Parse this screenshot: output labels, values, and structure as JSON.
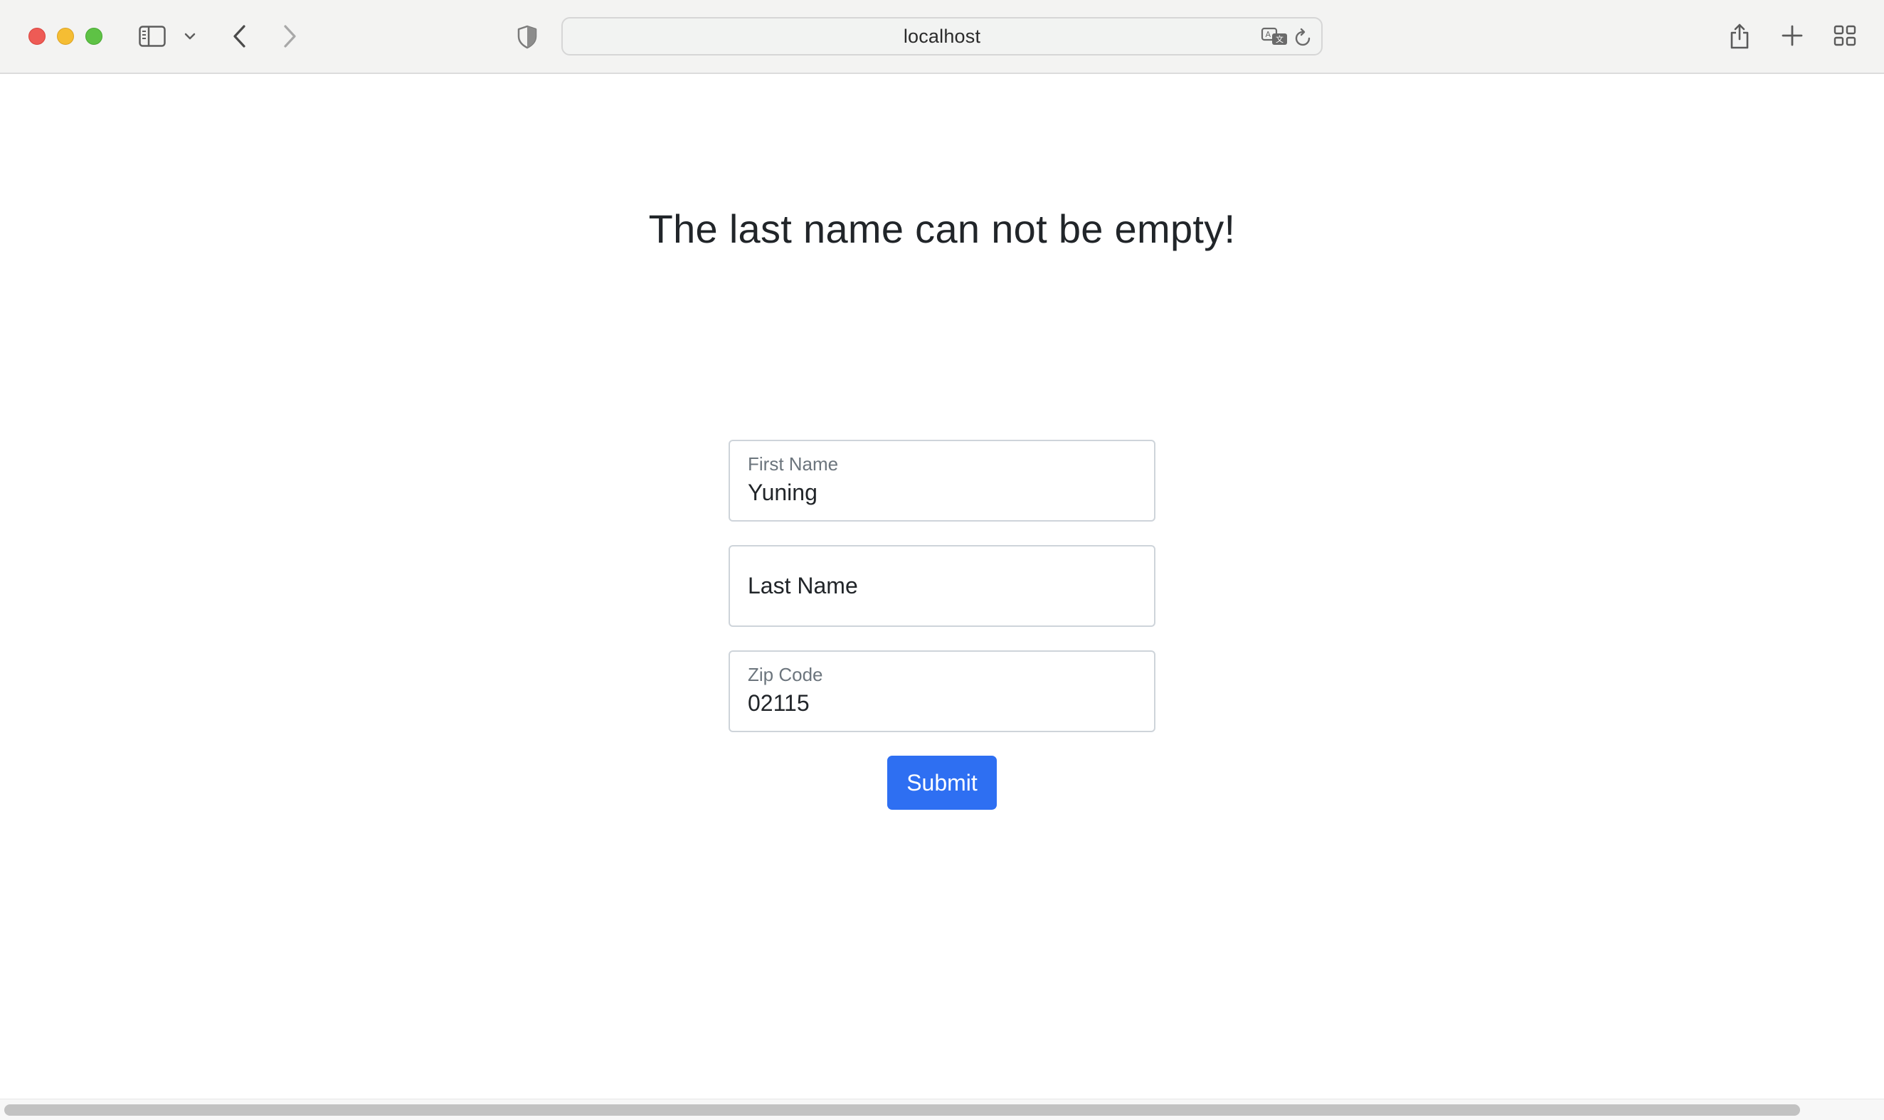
{
  "browser": {
    "url": "localhost",
    "icons": {
      "sidebar": "sidebar-icon",
      "sidebar_menu": "chevron-down-icon",
      "back": "chevron-left-icon",
      "forward": "chevron-right-icon",
      "privacy": "shield-icon",
      "translate": "translate-icon",
      "reload": "reload-icon",
      "share": "share-icon",
      "new_tab": "plus-icon",
      "tab_overview": "grid-icon"
    }
  },
  "page": {
    "heading": "The last name can not be empty!",
    "form": {
      "first_name": {
        "label": "First Name",
        "value": "Yuning"
      },
      "last_name": {
        "placeholder": "Last Name",
        "value": ""
      },
      "zip_code": {
        "label": "Zip Code",
        "value": "02115"
      },
      "submit_label": "Submit"
    }
  },
  "colors": {
    "primary_button": "#2e6ff2",
    "heading_text": "#212529",
    "field_label": "#6c757d"
  }
}
